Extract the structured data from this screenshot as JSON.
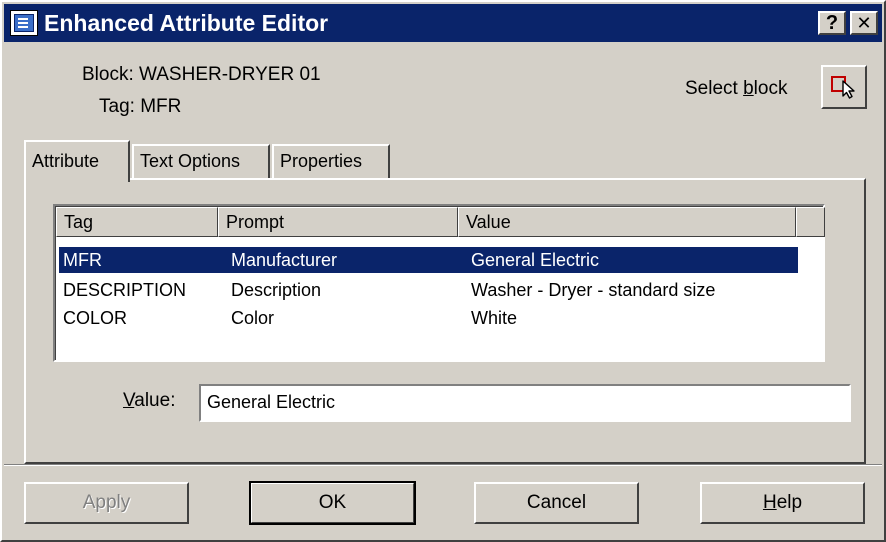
{
  "window": {
    "title": "Enhanced Attribute Editor",
    "help_button": "?",
    "close_button": "✕"
  },
  "header": {
    "block_text": "Block: WASHER-DRYER 01",
    "tag_text": "Tag: MFR",
    "select_block_prefix": "Select ",
    "select_block_accel": "b",
    "select_block_suffix": "lock"
  },
  "tabs": [
    {
      "label": "Attribute",
      "active": true
    },
    {
      "label": "Text Options",
      "active": false
    },
    {
      "label": "Properties",
      "active": false
    }
  ],
  "list": {
    "columns": [
      "Tag",
      "Prompt",
      "Value"
    ],
    "rows": [
      {
        "tag": "MFR",
        "prompt": "Manufacturer",
        "value": "General Electric",
        "selected": true
      },
      {
        "tag": "DESCRIPTION",
        "prompt": "Description",
        "value": "Washer - Dryer - standard size",
        "selected": false
      },
      {
        "tag": "COLOR",
        "prompt": "Color",
        "value": "White",
        "selected": false
      }
    ]
  },
  "value_field": {
    "label_accel": "V",
    "label_rest": "alue:",
    "value": "General Electric"
  },
  "buttons": {
    "apply": "Apply",
    "ok": "OK",
    "cancel": "Cancel",
    "help_accel": "H",
    "help_rest": "elp"
  },
  "colors": {
    "title_bar": "#0a246a",
    "dialog_bg": "#d4d0c8",
    "selection": "#0a246a"
  }
}
